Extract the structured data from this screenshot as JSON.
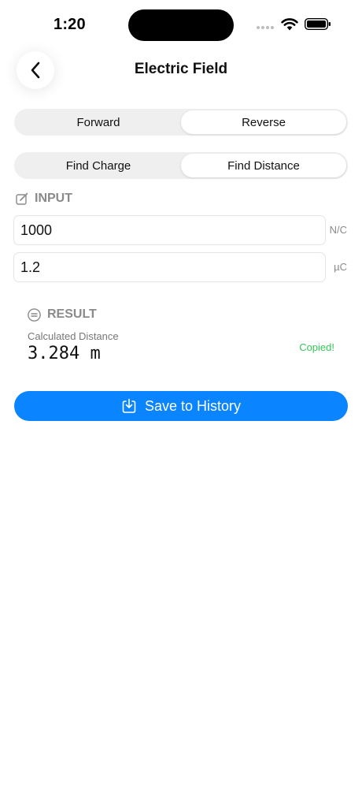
{
  "status_bar": {
    "time": "1:20",
    "icons": [
      "signal-dots-icon",
      "wifi-icon",
      "battery-icon"
    ]
  },
  "nav": {
    "back_icon": "chevron-left-icon",
    "title": "Electric Field"
  },
  "direction_tabs": [
    {
      "label": "Forward",
      "selected": false
    },
    {
      "label": "Reverse",
      "selected": true
    }
  ],
  "mode_tabs": [
    {
      "label": "Find Charge",
      "selected": false
    },
    {
      "label": "Find Distance",
      "selected": true
    }
  ],
  "input_section": {
    "icon": "edit-icon",
    "title": "INPUT",
    "fields": [
      {
        "value": "1000",
        "unit": "N/C"
      },
      {
        "value": "1.2",
        "unit": "µC"
      }
    ]
  },
  "result_section": {
    "icon": "equals-circle-icon",
    "title": "RESULT",
    "label": "Calculated Distance",
    "value": "3.284 m",
    "copied_text": "Copied!"
  },
  "save_button": {
    "icon": "save-tray-icon",
    "label": "Save to History"
  },
  "colors": {
    "accent": "#0a84ff",
    "success": "#34c759",
    "muted": "#8a8a8a",
    "segment_bg": "#efefef"
  }
}
